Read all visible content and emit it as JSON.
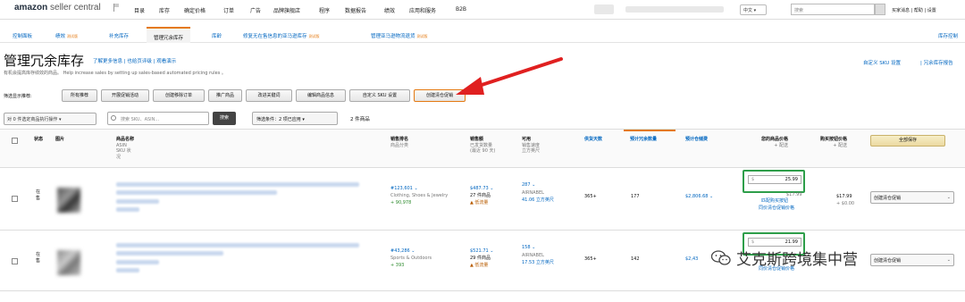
{
  "topnav": {
    "logo_bold": "amazon",
    "logo_rest": " seller central",
    "menu": [
      "目录",
      "库存",
      "确定价格",
      "订单",
      "广告",
      "品牌旗舰店",
      "程序",
      "数据报告",
      "绩效",
      "应用和服务",
      "B2B"
    ],
    "language": "中文",
    "search_placeholder": "搜索",
    "right_links": "买家消息 | 帮助 | 设置"
  },
  "subtabs": [
    {
      "label": "控制面板",
      "beta": ""
    },
    {
      "label": "绩效",
      "beta": "测试版"
    },
    {
      "label": "补充库存",
      "beta": ""
    },
    {
      "label": "管理冗余库存",
      "beta": ""
    },
    {
      "label": "库龄",
      "beta": ""
    },
    {
      "label": "修复无在售信息的亚马逊库存",
      "beta": "测试版"
    },
    {
      "label": "管理亚马逊物流退货",
      "beta": "测试版"
    }
  ],
  "subtab_right": "库存控制",
  "page": {
    "title": "管理冗余库存",
    "title_links": [
      "了解更多信息",
      "| 也给页评级",
      "| 观看演示"
    ],
    "subtitle": "有机会提高库存绩效的商品。 Help increase sales by setting up sales-based automated pricing rules 。",
    "right_links": [
      "自定义 SKU 设置",
      "| 冗余库存报告"
    ]
  },
  "filters": {
    "label": "筛选显示推荐:",
    "buttons": [
      "所有推荐",
      "开展促销活动",
      "创建移除订单",
      "推广商品",
      "改进关键词",
      "编辑商品信息",
      "自定义 SKU 设置",
      "创建清仓促销"
    ]
  },
  "toolbar": {
    "bulk_action": "对 0 件选定商品执行操作",
    "search_placeholder": "搜索 SKU、ASIN...",
    "search_button": "搜索",
    "condition": "筛选条件：2 项已应用",
    "count": "2 件商品"
  },
  "table": {
    "headers": [
      {
        "title": "状态",
        "sub": ""
      },
      {
        "title": "图片",
        "sub": ""
      },
      {
        "title": "商品名称",
        "sub": "ASIN SKU 状况"
      },
      {
        "title": "销售排名",
        "sub": "商品分类"
      },
      {
        "title": "销售额",
        "sub": "已发货数量 (最近 90 天)"
      },
      {
        "title": "可用",
        "sub": "销售速度 立方英尺"
      },
      {
        "title": "供货天数",
        "sub": ""
      },
      {
        "title": "预计冗余数量",
        "sub": ""
      },
      {
        "title": "预计仓储费",
        "sub": ""
      },
      {
        "title": "您的商品价格",
        "sub": "+ 配送"
      },
      {
        "title": "购买按钮价格",
        "sub": "+ 配送"
      }
    ],
    "save_all": "全部保存",
    "rows": [
      {
        "status": "在售",
        "rank": "#123,601",
        "category": "Clothing, Shoes & Jewelry",
        "rank_change": "+ 90,978",
        "sales": "$487.73",
        "units": "27 件商品",
        "sales_flag": "▲ 低流量",
        "available": "287",
        "asin_note": "AIRNABEL",
        "cubic": "41.06 立方英尺",
        "days": "365+",
        "excess": "177",
        "fee": "$2,806.68",
        "price": "25.99",
        "price_sub": "$17.99",
        "price_link": "匹配购买按钮",
        "lowest_link": "同价清仓促销价格",
        "buybox": "$17.99",
        "buybox_sub": "+ $0.00",
        "action": "创建清仓促销"
      },
      {
        "status": "在售",
        "rank": "#43,286",
        "category": "Sports & Outdoors",
        "rank_change": "+ 393",
        "sales": "$521.71",
        "units": "29 件商品",
        "sales_flag": "▲ 低流量",
        "available": "158",
        "asin_note": "AIRNABEL",
        "cubic": "17.53 立方英尺",
        "days": "365+",
        "excess": "142",
        "fee": "$2,43",
        "price": "21.99",
        "price_sub": "",
        "price_link": "",
        "lowest_link": "同价清仓促销价格",
        "buybox": "",
        "buybox_sub": "",
        "action": "创建清仓促销"
      }
    ]
  },
  "watermark": "艾克斯跨境集中营",
  "colors": {
    "accent": "#e47911",
    "link": "#0066c0",
    "price_border": "#2e9e4a",
    "arrow": "#e02020"
  }
}
